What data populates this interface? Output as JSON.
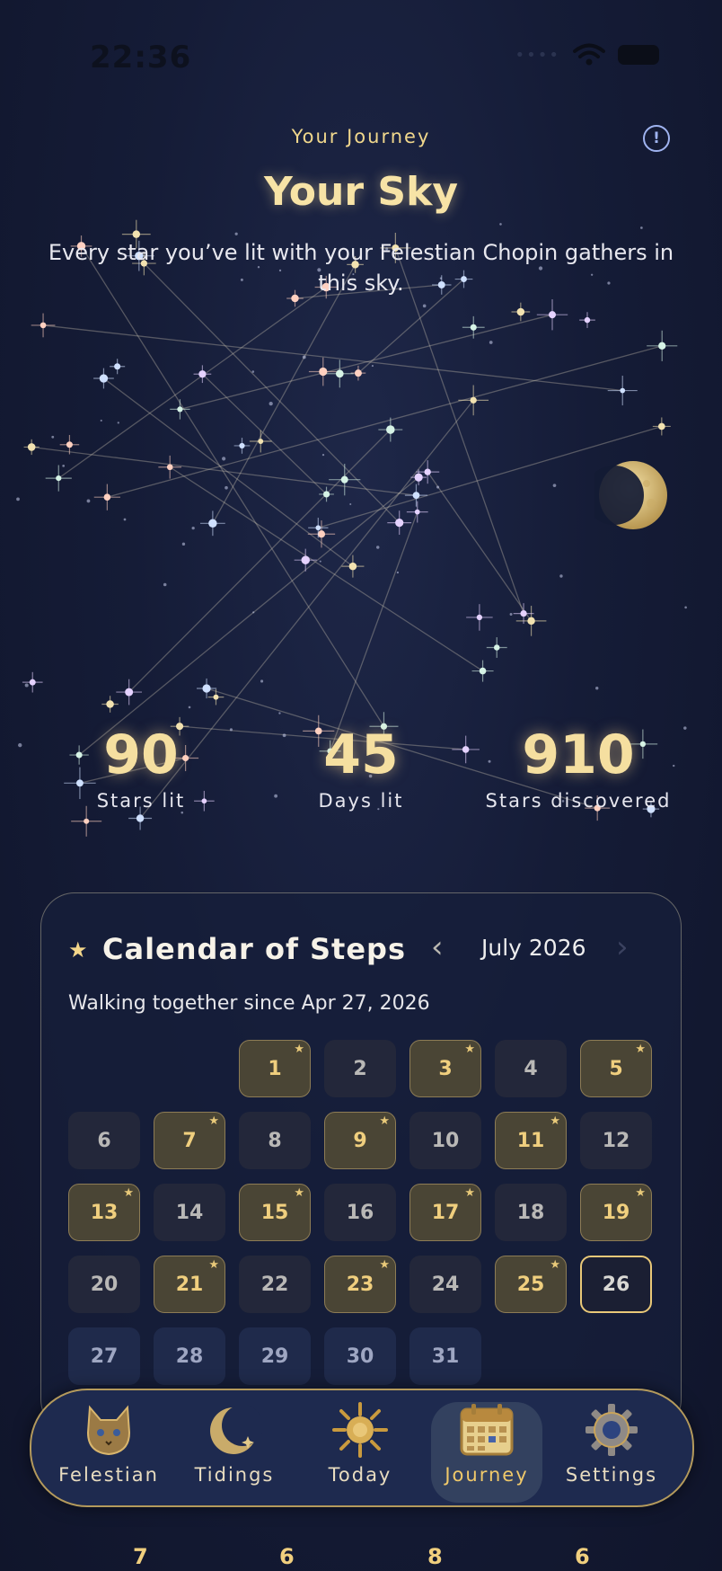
{
  "status": {
    "time": "22:36"
  },
  "header": {
    "eyebrow": "Your Journey",
    "info_icon": "info-icon",
    "title": "Your Sky",
    "subtitle": "Every star you’ve lit with your Felestian Chopin gathers in this sky."
  },
  "stats": [
    {
      "value": "90",
      "label": "Stars lit"
    },
    {
      "value": "45",
      "label": "Days lit"
    },
    {
      "value": "910",
      "label": "Stars discovered"
    }
  ],
  "calendar": {
    "title": "Calendar of Steps",
    "month": "July 2026",
    "since": "Walking together since Apr 27, 2026",
    "days": [
      {
        "d": "1",
        "state": "lit"
      },
      {
        "d": "2",
        "state": "none"
      },
      {
        "d": "3",
        "state": "lit"
      },
      {
        "d": "4",
        "state": "none"
      },
      {
        "d": "5",
        "state": "lit"
      },
      {
        "d": "6",
        "state": "none"
      },
      {
        "d": "7",
        "state": "lit"
      },
      {
        "d": "8",
        "state": "none"
      },
      {
        "d": "9",
        "state": "lit"
      },
      {
        "d": "10",
        "state": "none"
      },
      {
        "d": "11",
        "state": "lit"
      },
      {
        "d": "12",
        "state": "none"
      },
      {
        "d": "13",
        "state": "lit"
      },
      {
        "d": "14",
        "state": "none"
      },
      {
        "d": "15",
        "state": "lit"
      },
      {
        "d": "16",
        "state": "none"
      },
      {
        "d": "17",
        "state": "lit"
      },
      {
        "d": "18",
        "state": "none"
      },
      {
        "d": "19",
        "state": "lit"
      },
      {
        "d": "20",
        "state": "none"
      },
      {
        "d": "21",
        "state": "lit"
      },
      {
        "d": "22",
        "state": "none"
      },
      {
        "d": "23",
        "state": "lit"
      },
      {
        "d": "24",
        "state": "none"
      },
      {
        "d": "25",
        "state": "lit"
      },
      {
        "d": "26",
        "state": "today"
      },
      {
        "d": "27",
        "state": "future"
      },
      {
        "d": "28",
        "state": "future"
      },
      {
        "d": "29",
        "state": "future"
      },
      {
        "d": "30",
        "state": "future"
      },
      {
        "d": "31",
        "state": "future"
      }
    ]
  },
  "weeks_peek": [
    "7",
    "6",
    "8",
    "6"
  ],
  "tabs": [
    {
      "label": "Felestian",
      "icon": "cat-icon",
      "active": false
    },
    {
      "label": "Tidings",
      "icon": "crescent-moon-icon",
      "active": false
    },
    {
      "label": "Today",
      "icon": "sun-icon",
      "active": false
    },
    {
      "label": "Journey",
      "icon": "calendar-icon",
      "active": true
    },
    {
      "label": "Settings",
      "icon": "gear-icon",
      "active": false
    }
  ],
  "colors": {
    "gold": "#f0cf7e",
    "background": "#151c37",
    "accent_blue": "#9fb3f0"
  }
}
